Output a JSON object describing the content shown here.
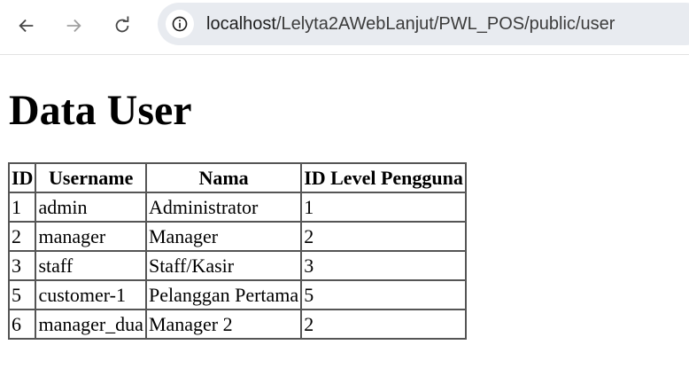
{
  "browser": {
    "url_host": "localhost",
    "url_path": "/Lelyta2AWebLanjut/PWL_POS/public/user"
  },
  "page": {
    "title": "Data User"
  },
  "table": {
    "headers": [
      "ID",
      "Username",
      "Nama",
      "ID Level Pengguna"
    ],
    "rows": [
      [
        "1",
        "admin",
        "Administrator",
        "1"
      ],
      [
        "2",
        "manager",
        "Manager",
        "2"
      ],
      [
        "3",
        "staff",
        "Staff/Kasir",
        "3"
      ],
      [
        "5",
        "customer-1",
        "Pelanggan Pertama",
        "5"
      ],
      [
        "6",
        "manager_dua",
        "Manager 2",
        "2"
      ]
    ]
  },
  "icons": {
    "back": "arrow-left-icon",
    "forward": "arrow-right-icon",
    "reload": "reload-icon",
    "site_info": "site-info-icon"
  }
}
